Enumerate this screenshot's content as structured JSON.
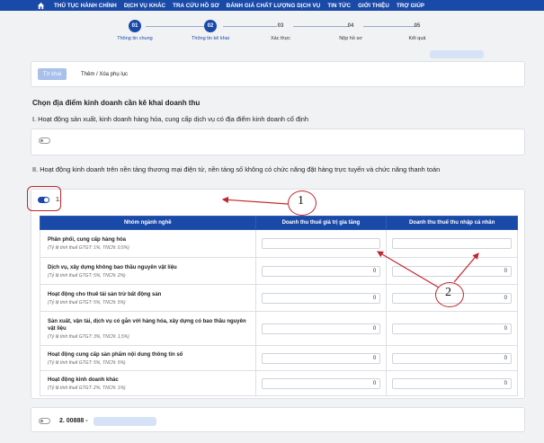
{
  "topnav": {
    "items": [
      "THỦ TỤC HÀNH CHÍNH",
      "DỊCH VỤ KHÁC",
      "TRA CỨU HỒ SƠ",
      "ĐÁNH GIÁ CHẤT LƯỢNG DỊCH VỤ",
      "TIN TỨC",
      "GIỚI THIỆU",
      "TRỢ GIÚP"
    ],
    "bg_color": "#1a4aa8"
  },
  "stepper": {
    "steps": [
      {
        "num": "01",
        "label": "Thông tin chung"
      },
      {
        "num": "02",
        "label": "Thông tin kê khai"
      },
      {
        "num": "03",
        "label": "Xác thực"
      },
      {
        "num": "04",
        "label": "Nộp hồ sơ"
      },
      {
        "num": "05",
        "label": "Kết quả"
      }
    ],
    "active_count": 2
  },
  "tabs": {
    "active": "Tờ khai",
    "other": "Thêm / Xóa phụ lục"
  },
  "form": {
    "title": "Chọn địa điểm kinh doanh cần kê khai doanh thu",
    "section1": "I. Hoạt động sản xuất, kinh doanh hàng hóa, cung cấp dịch vụ có địa điểm kinh doanh cố định",
    "section2": "II. Hoạt động kinh doanh trên nền tảng thương mại điện tử, nền tảng số không có chức năng đặt hàng trực tuyến và chức năng thanh toán",
    "item1_label": "1.",
    "item2_label": "2. 00888 -"
  },
  "table": {
    "headers": [
      "Nhóm ngành nghề",
      "Doanh thu thuế giá trị gia tăng",
      "Doanh thu thuế thu nhập cá nhân"
    ],
    "rows": [
      {
        "name": "Phân phối, cung cấp hàng hóa",
        "rate": "(Tỷ lệ tính thuế GTGT: 1%, TNCN: 0,5%)",
        "vat": "",
        "pit": ""
      },
      {
        "name": "Dịch vụ, xây dựng không bao thầu nguyên vật liệu",
        "rate": "(Tỷ lệ tính thuế GTGT: 5%, TNCN: 2%)",
        "vat": "0",
        "pit": "0"
      },
      {
        "name": "Hoạt động cho thuê tài sản trừ bất động sản",
        "rate": "(Tỷ lệ tính thuế GTGT: 5%, TNCN: 5%)",
        "vat": "0",
        "pit": "0"
      },
      {
        "name": "Sản xuất, vận tải, dịch vụ có gắn với hàng hóa, xây dựng có bao thầu nguyên vật liệu",
        "rate": "(Tỷ lệ tính thuế GTGT: 3%, TNCN: 1,5%)",
        "vat": "0",
        "pit": "0"
      },
      {
        "name": "Hoạt động cung cấp sản phẩm nội dung thông tin số",
        "rate": "(Tỷ lệ tính thuế GTGT: 5%, TNCN: 5%)",
        "vat": "0",
        "pit": "0"
      },
      {
        "name": "Hoạt động kinh doanh khác",
        "rate": "(Tỷ lệ tính thuế GTGT: 2%, TNCN: 1%)",
        "vat": "0",
        "pit": "0"
      }
    ]
  },
  "annotations": {
    "marker1": "1",
    "marker2": "2",
    "color": "#c1272d"
  }
}
